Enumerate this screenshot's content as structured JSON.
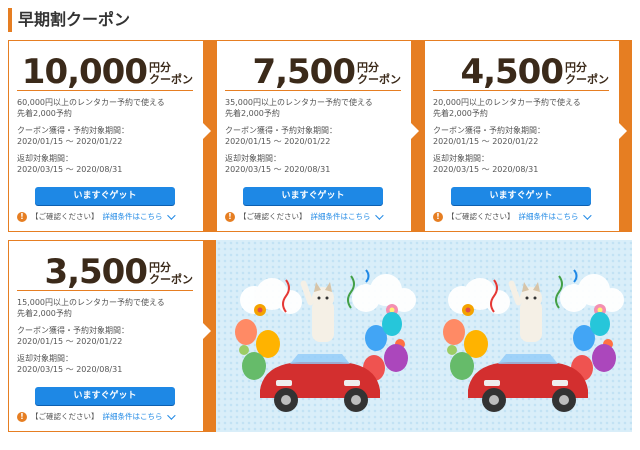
{
  "section_title": "早期割クーポン",
  "coupon_unit_line1": "円分",
  "coupon_unit_line2": "クーポン",
  "cards": [
    {
      "amount": "10,000",
      "condition": "60,000円以上のレンタカー予約で使える",
      "first_come": "先着2,000予約",
      "acquire_label": "クーポン獲得・予約対象期間：",
      "acquire_period": "2020/01/15 ～ 2020/01/22",
      "return_label": "返却対象期間：",
      "return_period": "2020/03/15 ～ 2020/08/31",
      "button": "いますぐゲット",
      "notice": "【ご確認ください】",
      "detail": "詳細条件はこちら"
    },
    {
      "amount": "7,500",
      "condition": "35,000円以上のレンタカー予約で使える",
      "first_come": "先着2,000予約",
      "acquire_label": "クーポン獲得・予約対象期間：",
      "acquire_period": "2020/01/15 ～ 2020/01/22",
      "return_label": "返却対象期間：",
      "return_period": "2020/03/15 ～ 2020/08/31",
      "button": "いますぐゲット",
      "notice": "【ご確認ください】",
      "detail": "詳細条件はこちら"
    },
    {
      "amount": "4,500",
      "condition": "20,000円以上のレンタカー予約で使える",
      "first_come": "先着2,000予約",
      "acquire_label": "クーポン獲得・予約対象期間：",
      "acquire_period": "2020/01/15 ～ 2020/01/22",
      "return_label": "返却対象期間：",
      "return_period": "2020/03/15 ～ 2020/08/31",
      "button": "いますぐゲット",
      "notice": "【ご確認ください】",
      "detail": "詳細条件はこちら"
    },
    {
      "amount": "3,500",
      "condition": "15,000円以上のレンタカー予約で使える",
      "first_come": "先着2,000予約",
      "acquire_label": "クーポン獲得・予約対象期間：",
      "acquire_period": "2020/01/15 ～ 2020/01/22",
      "return_label": "返却対象期間：",
      "return_period": "2020/03/15 ～ 2020/08/31",
      "button": "いますぐゲット",
      "notice": "【ご確認ください】",
      "detail": "詳細条件はこちら"
    }
  ],
  "colors": {
    "accent": "#e67e22",
    "button": "#1e88e5",
    "amount_text": "#3b2a1a",
    "promo_bg": "#d9eef9"
  },
  "icons": {
    "warning": "warning-icon",
    "chevron": "chevron-down-icon"
  }
}
